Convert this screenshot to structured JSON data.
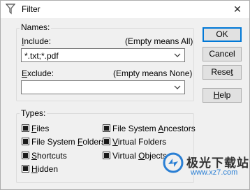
{
  "window": {
    "title": "Filter",
    "close_glyph": "✕"
  },
  "names_group": {
    "legend": "Names:",
    "include": {
      "label_prefix": "",
      "label_underlined": "I",
      "label_rest": "nclude:",
      "hint": "(Empty means All)",
      "value": "*.txt;*.pdf"
    },
    "exclude": {
      "label_prefix": "",
      "label_underlined": "E",
      "label_rest": "xclude:",
      "hint": "(Empty means None)",
      "value": ""
    }
  },
  "buttons": {
    "ok": "OK",
    "cancel": "Cancel",
    "reset_prefix": "Rese",
    "reset_underlined": "t",
    "help_underlined": "H",
    "help_rest": "elp"
  },
  "types_group": {
    "legend": "Types:",
    "items": [
      {
        "pre": "",
        "ul": "F",
        "post": "iles",
        "checked": true
      },
      {
        "pre": "File System ",
        "ul": "F",
        "post": "olders",
        "checked": true
      },
      {
        "pre": "",
        "ul": "S",
        "post": "hortcuts",
        "checked": true
      },
      {
        "pre": "",
        "ul": "H",
        "post": "idden",
        "checked": true
      },
      {
        "pre": "File System ",
        "ul": "A",
        "post": "ncestors",
        "checked": true
      },
      {
        "pre": "",
        "ul": "V",
        "post": "irtual Folders",
        "checked": true
      },
      {
        "pre": "Virtual ",
        "ul": "O",
        "post": "bjects",
        "checked": true
      }
    ]
  },
  "watermark": {
    "text": "极光下载站",
    "url": "www.xz7.com",
    "logo_color": "#2a7fd4"
  }
}
